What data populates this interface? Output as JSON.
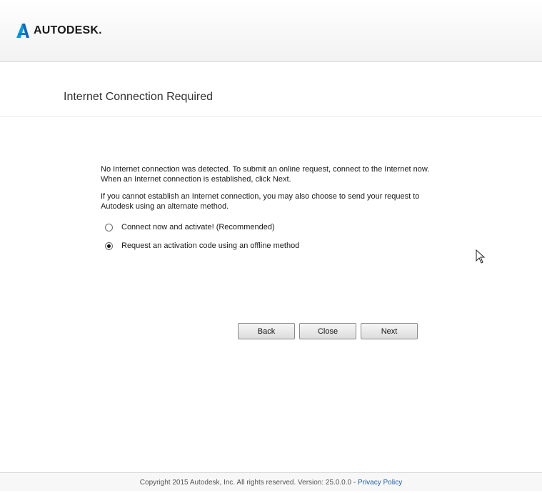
{
  "header": {
    "logo_text": "AUTODESK."
  },
  "page": {
    "title": "Internet Connection Required"
  },
  "message": {
    "line1": "No Internet connection was detected. To submit an online request, connect to the Internet now.",
    "line2": "When an Internet connection is established, click Next.",
    "line3": "If you cannot establish an Internet connection, you may also choose to send your request to",
    "line4": "Autodesk using an alternate method."
  },
  "options": [
    {
      "label": "Connect now and activate! (Recommended)",
      "selected": false
    },
    {
      "label": "Request an activation code using an offline method",
      "selected": true
    }
  ],
  "buttons": {
    "back": "Back",
    "close": "Close",
    "next": "Next"
  },
  "footer": {
    "copyright": "Copyright 2015 Autodesk, Inc. All rights reserved. Version: 25.0.0.0 - ",
    "privacy_link": "Privacy Policy"
  },
  "colors": {
    "link": "#1b5fa8",
    "brand": "#1a1a1a"
  }
}
